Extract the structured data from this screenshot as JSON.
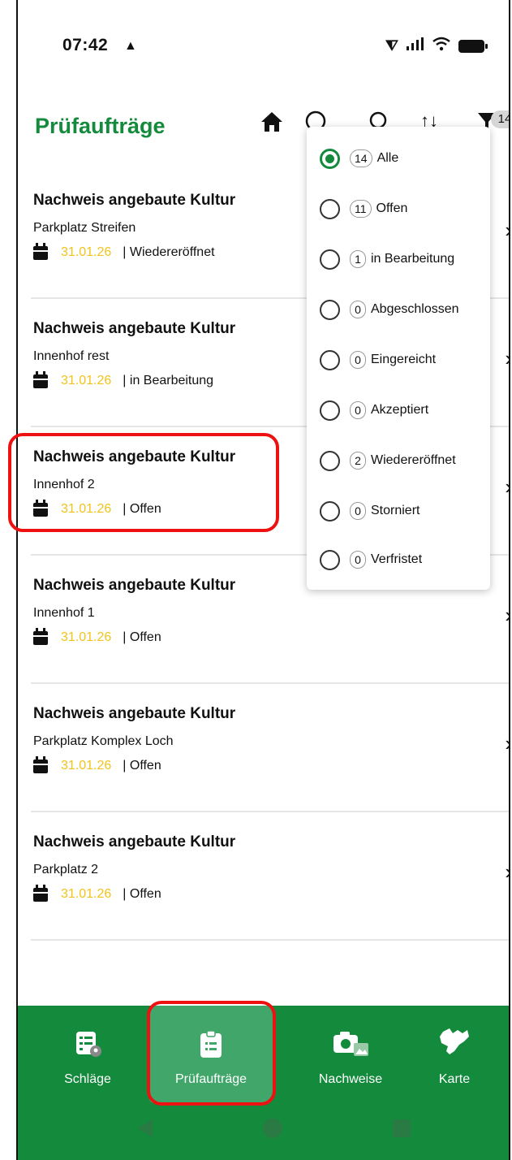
{
  "status_bar": {
    "time": "07:42"
  },
  "header": {
    "title": "Prüfaufträge",
    "filter_count": "14"
  },
  "list": [
    {
      "title": "Nachweis angebaute Kultur",
      "subtitle": "Parkplatz Streifen",
      "date": "31.01.26",
      "status": "| Wiedereröffnet"
    },
    {
      "title": "Nachweis angebaute Kultur",
      "subtitle": "Innenhof rest",
      "date": "31.01.26",
      "status": "| in Bearbeitung"
    },
    {
      "title": "Nachweis angebaute Kultur",
      "subtitle": "Innenhof 2",
      "date": "31.01.26",
      "status": "| Offen"
    },
    {
      "title": "Nachweis angebaute Kultur",
      "subtitle": "Innenhof 1",
      "date": "31.01.26",
      "status": "| Offen"
    },
    {
      "title": "Nachweis angebaute Kultur",
      "subtitle": "Parkplatz Komplex Loch",
      "date": "31.01.26",
      "status": "| Offen"
    },
    {
      "title": "Nachweis angebaute Kultur",
      "subtitle": "Parkplatz 2",
      "date": "31.01.26",
      "status": "| Offen"
    }
  ],
  "filter_menu": {
    "selected": "Alle",
    "options": [
      {
        "count": "14",
        "label": "Alle"
      },
      {
        "count": "11",
        "label": "Offen"
      },
      {
        "count": "1",
        "label": "in Bearbeitung"
      },
      {
        "count": "0",
        "label": "Abgeschlossen"
      },
      {
        "count": "0",
        "label": "Eingereicht"
      },
      {
        "count": "0",
        "label": "Akzeptiert"
      },
      {
        "count": "2",
        "label": "Wiedereröffnet"
      },
      {
        "count": "0",
        "label": "Storniert"
      },
      {
        "count": "0",
        "label": "Verfristet"
      }
    ]
  },
  "bottom_nav": {
    "items": [
      {
        "label": "Schläge",
        "icon": "list-location-icon"
      },
      {
        "label": "Prüfaufträge",
        "icon": "clipboard-icon"
      },
      {
        "label": "Nachweise",
        "icon": "camera-gallery-icon"
      },
      {
        "label": "Karte",
        "icon": "saxony-map-icon"
      }
    ],
    "active": "Prüfaufträge"
  },
  "colors": {
    "primary": "#138a3c",
    "active_nav": "#41a66a",
    "date": "#f2c31a",
    "highlight": "#ee1111"
  }
}
